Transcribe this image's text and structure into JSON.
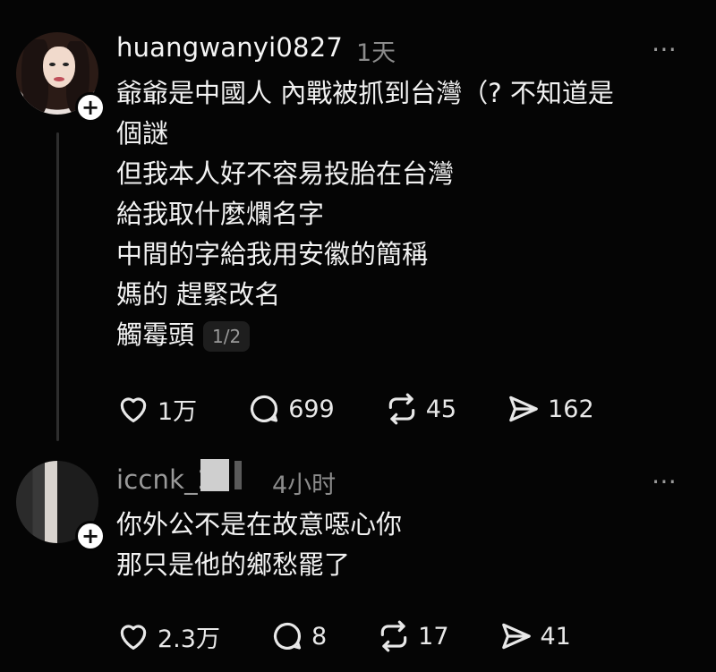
{
  "posts": [
    {
      "username": "huangwanyi0827",
      "time": "1天",
      "lines": [
        "爺爺是中國人 內戰被抓到台灣（? 不知道是",
        "個謎",
        "但我本人好不容易投胎在台灣",
        "給我取什麼爛名字",
        "中間的字給我用安徽的簡稱",
        "媽的 趕緊改名",
        "觸霉頭"
      ],
      "page_indicator": "1/2",
      "actions": {
        "likes": "1万",
        "comments": "699",
        "reposts": "45",
        "shares": "162"
      }
    },
    {
      "username": "iccnk_21",
      "time": "4小时",
      "lines": [
        "你外公不是在故意噁心你",
        "那只是他的鄉愁罷了"
      ],
      "actions": {
        "likes": "2.3万",
        "comments": "8",
        "reposts": "17",
        "shares": "41"
      }
    }
  ],
  "more_icon": "⋯",
  "plus_icon": "+",
  "icons": [
    "heart-icon",
    "comment-icon",
    "repost-icon",
    "share-icon",
    "more-icon",
    "follow-plus-icon"
  ]
}
